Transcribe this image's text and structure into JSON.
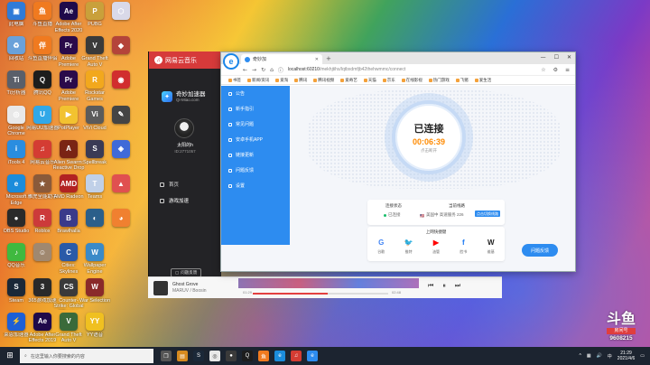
{
  "desktop_icons": [
    {
      "label": "此电脑",
      "icon": "computer-icon",
      "color": "#2f7bd8",
      "glyph": "▣"
    },
    {
      "label": "斗鱼直播",
      "icon": "douyu-icon",
      "color": "#f07a1f",
      "glyph": "鱼"
    },
    {
      "label": "Adobe After Effects 2020",
      "icon": "ae-icon",
      "color": "#1f0a4a",
      "glyph": "Ae"
    },
    {
      "label": "PUBG",
      "icon": "pubg-icon",
      "color": "#c9a03b",
      "glyph": "P"
    },
    {
      "label": "",
      "icon": "app-icon",
      "color": "#d9d9e8",
      "glyph": "⬡"
    },
    {
      "label": "回收站",
      "icon": "recycle-bin-icon",
      "color": "#6aa1d9",
      "glyph": "♻"
    },
    {
      "label": "斗鱼直播伴侣",
      "icon": "douyu-companion-icon",
      "color": "#f07a1f",
      "glyph": "伴"
    },
    {
      "label": "Adobe Premiere",
      "icon": "pr-icon",
      "color": "#2a0a4a",
      "glyph": "Pr"
    },
    {
      "label": "Grand Theft Auto V",
      "icon": "gta-icon",
      "color": "#3a3a3a",
      "glyph": "V"
    },
    {
      "label": "",
      "icon": "game-icon",
      "color": "#b4443a",
      "glyph": "◆"
    },
    {
      "label": "Ti分析器",
      "icon": "analyzer-icon",
      "color": "#5a5f6a",
      "glyph": "Ti"
    },
    {
      "label": "腾讯QQ",
      "icon": "qq-icon",
      "color": "#1d1d1d",
      "glyph": "Q"
    },
    {
      "label": "Adobe Premiere",
      "icon": "pr-icon",
      "color": "#2a0a4a",
      "glyph": "Pr"
    },
    {
      "label": "Rockstar Games",
      "icon": "rockstar-icon",
      "color": "#f2a81d",
      "glyph": "R"
    },
    {
      "label": "",
      "icon": "app-icon",
      "color": "#d12e2e",
      "glyph": "◉"
    },
    {
      "label": "Google Chrome",
      "icon": "chrome-icon",
      "color": "#e8e8e8",
      "glyph": "◎"
    },
    {
      "label": "网易UU加速器",
      "icon": "uu-icon",
      "color": "#31a8e8",
      "glyph": "U"
    },
    {
      "label": "PotPlayer",
      "icon": "potplayer-icon",
      "color": "#f2c230",
      "glyph": "▶"
    },
    {
      "label": "ViVi Cloud",
      "icon": "vivi-icon",
      "color": "#5b5b5b",
      "glyph": "Vi"
    },
    {
      "label": "",
      "icon": "tool-icon",
      "color": "#444",
      "glyph": "✎"
    },
    {
      "label": "iTools 4",
      "icon": "itools-icon",
      "color": "#2a8de0",
      "glyph": "i"
    },
    {
      "label": "网易云音乐",
      "icon": "netease-music-icon",
      "color": "#d43c33",
      "glyph": "♫"
    },
    {
      "label": "Alien Swarm: Reactive Drop",
      "icon": "alien-swarm-icon",
      "color": "#7a2414",
      "glyph": "A"
    },
    {
      "label": "Spellbreak",
      "icon": "spellbreak-icon",
      "color": "#3a3a55",
      "glyph": "S"
    },
    {
      "label": "",
      "icon": "app-icon",
      "color": "#3f6ad8",
      "glyph": "◈"
    },
    {
      "label": "Microsoft Edge",
      "icon": "edge-icon",
      "color": "#1b8cdb",
      "glyph": "e"
    },
    {
      "label": "雅虎全能助手",
      "icon": "helper-icon",
      "color": "#8a5a3a",
      "glyph": "★"
    },
    {
      "label": "AMD Radeon",
      "icon": "amd-icon",
      "color": "#b22222",
      "glyph": "AMD"
    },
    {
      "label": "Teams",
      "icon": "teams-icon",
      "color": "#c0d0e8",
      "glyph": "T"
    },
    {
      "label": "",
      "icon": "app-icon",
      "color": "#e05050",
      "glyph": "▲"
    },
    {
      "label": "OBS Studio",
      "icon": "obs-icon",
      "color": "#2a2a2a",
      "glyph": "●"
    },
    {
      "label": "Roblox",
      "icon": "roblox-icon",
      "color": "#cc3a3a",
      "glyph": "R"
    },
    {
      "label": "Brawlhalla",
      "icon": "brawlhalla-icon",
      "color": "#3a3a8a",
      "glyph": "B"
    },
    {
      "label": "",
      "icon": "game-icon",
      "color": "#2b5f8a",
      "glyph": "◐"
    },
    {
      "label": "",
      "icon": "fox-icon",
      "color": "#f08030",
      "glyph": "◕"
    },
    {
      "label": "QQ音乐",
      "icon": "qq-music-icon",
      "color": "#3fb93f",
      "glyph": "♪"
    },
    {
      "label": "",
      "icon": "avatar-icon",
      "color": "#a08870",
      "glyph": "☺"
    },
    {
      "label": "Cities: Skylines",
      "icon": "cities-icon",
      "color": "#2a5aa8",
      "glyph": "C"
    },
    {
      "label": "Wallpaper Engine",
      "icon": "wallpaper-engine-icon",
      "color": "#3a8ac8",
      "glyph": "W"
    },
    {
      "label": "",
      "icon": "blank-icon",
      "color": "transparent",
      "glyph": ""
    },
    {
      "label": "Steam",
      "icon": "steam-icon",
      "color": "#1b2838",
      "glyph": "S"
    },
    {
      "label": "365游戏加速",
      "icon": "accelerator-icon",
      "color": "#2a2a2a",
      "glyph": "3"
    },
    {
      "label": "Counter-Strike: Global Offensive",
      "icon": "csgo-icon",
      "color": "#3a3a3a",
      "glyph": "CS"
    },
    {
      "label": "War Selection",
      "icon": "war-icon",
      "color": "#8a2a2a",
      "glyph": "W"
    },
    {
      "label": "",
      "icon": "blank-icon",
      "color": "transparent",
      "glyph": ""
    },
    {
      "label": "莱恩加速器",
      "icon": "lian-icon",
      "color": "#1d5fd6",
      "glyph": "⚡"
    },
    {
      "label": "Adobe After Effects 2019",
      "icon": "ae-icon",
      "color": "#1f0a4a",
      "glyph": "Ae"
    },
    {
      "label": "Grand Theft Auto V",
      "icon": "gta-icon",
      "color": "#3a6a3a",
      "glyph": "V"
    },
    {
      "label": "YY语音",
      "icon": "yy-icon",
      "color": "#f0c020",
      "glyph": "YY"
    }
  ],
  "netease": {
    "header": "网易云音乐",
    "app_name": "奇妙加速器",
    "app_sub": "Qi-Miao.com",
    "username": "太阳的h",
    "user_id": "ID:2771057",
    "menu": [
      "首页",
      "游戏加速"
    ],
    "feedback": "问题反馈",
    "song": "Ghost Grove",
    "artist": "MARUV / Boosin",
    "time_current": "01:29",
    "time_total": "02:48"
  },
  "browser": {
    "tab_title": "奇妙加",
    "url_host": "localhost:60210",
    "url_rest": "/mekhjtihs/lqtbxdmfjb42thehwmmc/connect",
    "bookmarks": [
      "书签",
      "新闻/资讯",
      "爱淘",
      "腾讯",
      "腾讯视频",
      "爱奇艺",
      "天猫",
      "京东",
      "在线影视",
      "热门游戏",
      "飞猪",
      "爱生活"
    ],
    "side_menu": [
      "公告",
      "新手指引",
      "常见问题",
      "安卓手机APP",
      "链接更新",
      "问题反馈",
      "设置"
    ]
  },
  "vpn": {
    "state": "已连接",
    "timer": "00:06:39",
    "disconnect": "点击断开",
    "status_label": "连接状态",
    "status_value": "已连接",
    "node_label": "当前线路",
    "node_value": "美国中 高速服务 226",
    "change_btn": "点击切换线路",
    "quick_title": "上网快捷键",
    "links": [
      {
        "label": "谷歌",
        "icon": "google-icon",
        "glyph": "G",
        "color": "#4285f4"
      },
      {
        "label": "推特",
        "icon": "twitter-icon",
        "glyph": "🐦",
        "color": "#1da1f2"
      },
      {
        "label": "油管",
        "icon": "youtube-icon",
        "glyph": "▶",
        "color": "#ff0000"
      },
      {
        "label": "脸书",
        "icon": "facebook-icon",
        "glyph": "f",
        "color": "#1877f2"
      },
      {
        "label": "维基",
        "icon": "wikipedia-icon",
        "glyph": "W",
        "color": "#222222"
      }
    ],
    "feedback_btn": "问题反馈"
  },
  "watermark": {
    "logo": "斗鱼",
    "box": "房间号",
    "room": "9608215"
  },
  "taskbar": {
    "search_placeholder": "在这里输入你要搜索的内容",
    "time": "21:29",
    "date": "2021/4/6"
  }
}
